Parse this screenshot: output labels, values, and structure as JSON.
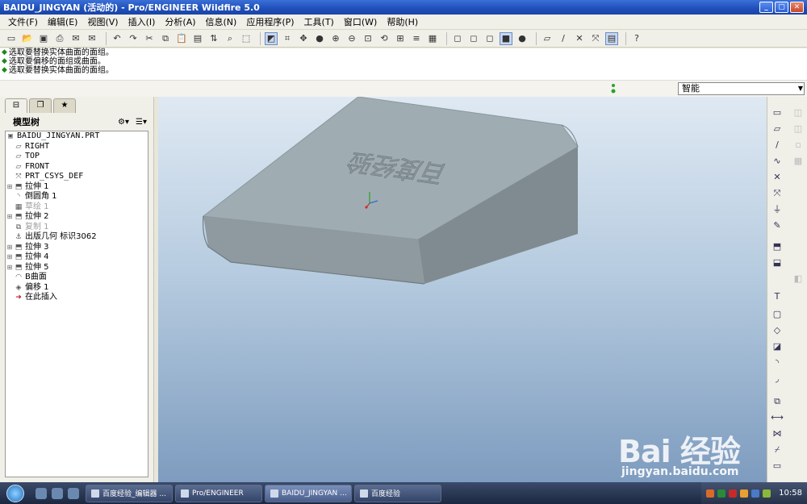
{
  "window": {
    "title": "BAIDU_JINGYAN (活动的) - Pro/ENGINEER Wildfire 5.0"
  },
  "menu": [
    "文件(F)",
    "编辑(E)",
    "视图(V)",
    "插入(I)",
    "分析(A)",
    "信息(N)",
    "应用程序(P)",
    "工具(T)",
    "窗口(W)",
    "帮助(H)"
  ],
  "messages": [
    "选取要替换实体曲面的面组。",
    "选取要偏移的面组或曲面。",
    "选取要替换实体曲面的面组。"
  ],
  "filter": {
    "value": "智能"
  },
  "model_tree": {
    "title": "模型树",
    "root": "BAIDU_JINGYAN.PRT",
    "items": [
      {
        "label": "RIGHT",
        "icon": "datum-plane-icon",
        "expandable": false,
        "dim": false,
        "mono": true
      },
      {
        "label": "TOP",
        "icon": "datum-plane-icon",
        "expandable": false,
        "dim": false,
        "mono": true
      },
      {
        "label": "FRONT",
        "icon": "datum-plane-icon",
        "expandable": false,
        "dim": false,
        "mono": true
      },
      {
        "label": "PRT_CSYS_DEF",
        "icon": "csys-icon",
        "expandable": false,
        "dim": false,
        "mono": true
      },
      {
        "label": "拉伸 1",
        "icon": "extrude-icon",
        "expandable": true,
        "dim": false,
        "mono": false
      },
      {
        "label": "倒圆角 1",
        "icon": "round-icon",
        "expandable": false,
        "dim": false,
        "mono": false
      },
      {
        "label": "草绘 1",
        "icon": "sketch-icon",
        "expandable": false,
        "dim": true,
        "mono": false
      },
      {
        "label": "拉伸 2",
        "icon": "extrude-icon",
        "expandable": true,
        "dim": false,
        "mono": false
      },
      {
        "label": "复制 1",
        "icon": "copy-icon",
        "expandable": false,
        "dim": true,
        "mono": false
      },
      {
        "label": "出版几何 标识3062",
        "icon": "publish-geom-icon",
        "expandable": false,
        "dim": false,
        "mono": false
      },
      {
        "label": "拉伸 3",
        "icon": "extrude-icon",
        "expandable": true,
        "dim": false,
        "mono": false
      },
      {
        "label": "拉伸 4",
        "icon": "extrude-icon",
        "expandable": true,
        "dim": false,
        "mono": false
      },
      {
        "label": "拉伸 5",
        "icon": "extrude-icon",
        "expandable": true,
        "dim": false,
        "mono": false
      },
      {
        "label": "B曲面",
        "icon": "surface-icon",
        "expandable": false,
        "dim": false,
        "mono": false
      },
      {
        "label": "偏移 1",
        "icon": "offset-icon",
        "expandable": false,
        "dim": false,
        "mono": false
      },
      {
        "label": "在此插入",
        "icon": "insert-here-icon",
        "expandable": false,
        "dim": false,
        "mono": false,
        "insert": true
      }
    ]
  },
  "model": {
    "engraved_text": "百度经验"
  },
  "watermark": {
    "brand": "Bai 经验",
    "url": "jingyan.baidu.com"
  },
  "taskbar": {
    "tasks": [
      "百度经验_编辑器 ...",
      "Pro/ENGINEER",
      "BAIDU_JINGYAN ...",
      "百度经验"
    ],
    "clock": "10:58"
  }
}
